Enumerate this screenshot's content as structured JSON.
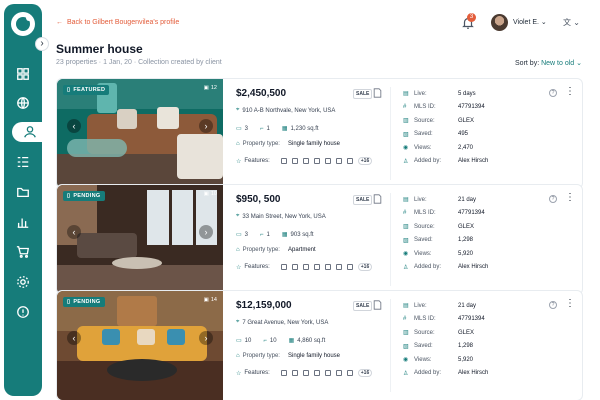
{
  "nav": {
    "items": [
      {
        "icon": "dashboard-icon"
      },
      {
        "icon": "globe-icon"
      },
      {
        "icon": "users-icon",
        "active": true
      },
      {
        "icon": "list-icon"
      },
      {
        "icon": "folder-icon"
      },
      {
        "icon": "bar-chart-icon"
      },
      {
        "icon": "cart-icon"
      },
      {
        "icon": "gear-icon"
      },
      {
        "icon": "help-icon"
      }
    ],
    "collapse_glyph": "›"
  },
  "header": {
    "back_link": "Back to Gilbert Bougenvilea's profile",
    "title": "Summer house",
    "subtitle": "23 properties · 1 Jan, 20 · Collection created by client",
    "sort_label": "Sort by:",
    "sort_value": "New to old",
    "notifications_count": "3",
    "user_name": "Violet E.",
    "lang_icon": "translate-icon"
  },
  "labels": {
    "property_type": "Property type:",
    "features": "Features:",
    "live": "Live:",
    "mls": "MLS ID:",
    "source": "Source:",
    "saved": "Saved:",
    "views": "Views:",
    "added_by": "Added by:",
    "sale": "SALE",
    "help": "?",
    "more": "⋮"
  },
  "listings": [
    {
      "status": "FEATURED",
      "photo_count": "12",
      "price": "$2,450,500",
      "address": "910 A-B Northvale, New York, USA",
      "beds": "3",
      "baths": "1",
      "area": "1,230 sq.ft",
      "property_type": "Single family house",
      "features_more": "+16",
      "live": "5 days",
      "mls_id": "47791394",
      "source": "GLEX",
      "saved": "495",
      "views": "2,470",
      "added_by": "Alex Hirsch"
    },
    {
      "status": "PENDING",
      "photo_count": "10",
      "price": "$950, 500",
      "address": "33 Main Street, New York, USA",
      "beds": "3",
      "baths": "1",
      "area": "903 sq.ft",
      "property_type": "Apartment",
      "features_more": "+16",
      "live": "21 day",
      "mls_id": "47791394",
      "source": "GLEX",
      "saved": "1,298",
      "views": "5,920",
      "added_by": "Alex Hirsch"
    },
    {
      "status": "PENDING",
      "photo_count": "14",
      "price": "$12,159,000",
      "address": "7 Great Avenue, New York, USA",
      "beds": "10",
      "baths": "10",
      "area": "4,860 sq.ft",
      "property_type": "Single family house",
      "features_more": "+16",
      "live": "21 day",
      "mls_id": "47791394",
      "source": "GLEX",
      "saved": "1,298",
      "views": "5,920",
      "added_by": "Alex Hirsch"
    }
  ]
}
